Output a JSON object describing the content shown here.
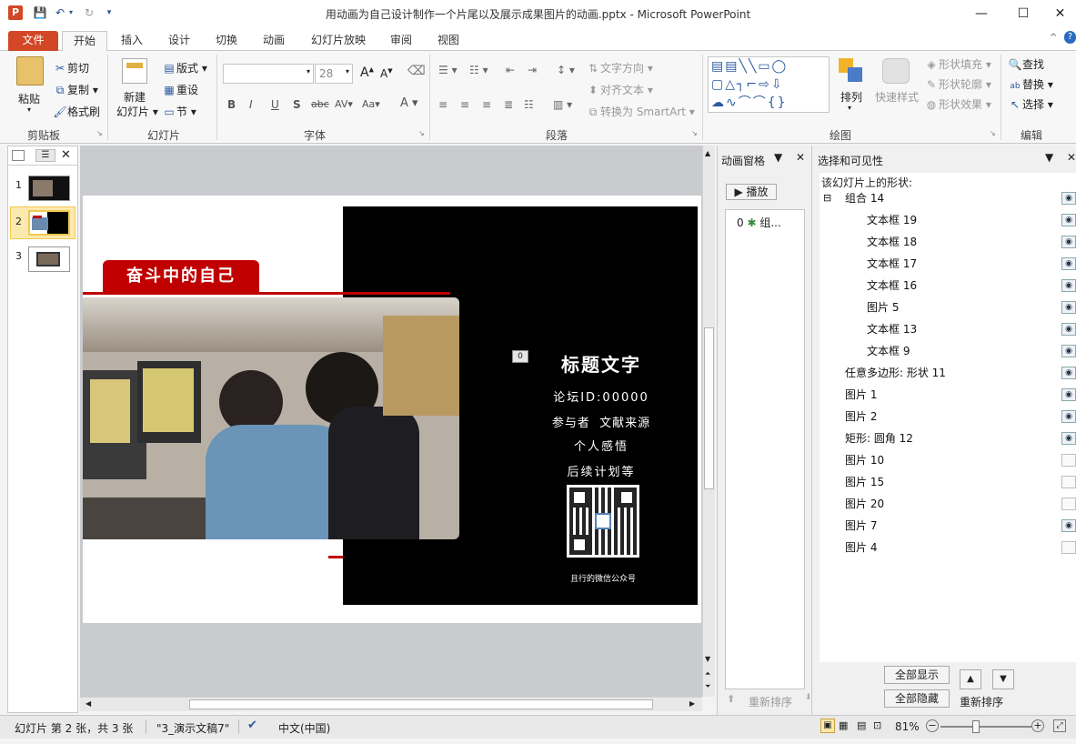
{
  "window": {
    "title": "用动画为自己设计制作一个片尾以及展示成果图片的动画.pptx - Microsoft PowerPoint",
    "app_icon": "P",
    "controls": {
      "minimize": "—",
      "maximize": "☐",
      "close": "✕"
    }
  },
  "tabs": [
    "文件",
    "开始",
    "插入",
    "设计",
    "切换",
    "动画",
    "幻灯片放映",
    "审阅",
    "视图"
  ],
  "active_tab": "开始",
  "ribbon": {
    "clipboard": {
      "paste": "粘贴",
      "cut": "剪切",
      "copy": "复制",
      "format_painter": "格式刷",
      "label": "剪贴板"
    },
    "slides": {
      "new_slide_1": "新建",
      "new_slide_2": "幻灯片",
      "layout": "版式",
      "reset": "重设",
      "section": "节",
      "label": "幻灯片"
    },
    "font": {
      "font_name": "",
      "font_size": "28",
      "label": "字体",
      "grow": "A",
      "shrink": "A",
      "bold": "B",
      "italic": "I",
      "underline": "U",
      "shadow": "S",
      "strike": "abc",
      "spacing": "AV",
      "case": "Aa",
      "color": "A"
    },
    "paragraph": {
      "text_direction": "文字方向",
      "align_text": "对齐文本",
      "smartart": "转换为 SmartArt",
      "label": "段落"
    },
    "drawing": {
      "arrange": "排列",
      "quick_styles": "快速样式",
      "shape_fill": "形状填充",
      "shape_outline": "形状轮廓",
      "shape_effects": "形状效果",
      "label": "绘图"
    },
    "editing": {
      "find": "查找",
      "replace": "替换",
      "select": "选择",
      "label": "编辑"
    }
  },
  "slides_pane": {
    "thumbnails": [
      "1",
      "2",
      "3"
    ],
    "selected": "2"
  },
  "slide": {
    "banner": "奋斗中的自己",
    "anim_tag": "0",
    "title": "标题文字",
    "lines": [
      "论坛ID:00000",
      "参与者  文献来源",
      "个人感悟",
      "后续计划等"
    ],
    "qr_caption": "且行的微信公众号"
  },
  "animation_pane": {
    "title": "动画窗格",
    "play": "播放",
    "item": {
      "index": "0",
      "label": "组..."
    },
    "reorder": "重新排序"
  },
  "selection_pane": {
    "title": "选择和可见性",
    "subtitle": "该幻灯片上的形状:",
    "items": [
      {
        "name": "组合  14",
        "level": 0,
        "expander": "⊟",
        "visible": true
      },
      {
        "name": "文本框  19",
        "level": 1,
        "visible": true
      },
      {
        "name": "文本框  18",
        "level": 1,
        "visible": true
      },
      {
        "name": "文本框  17",
        "level": 1,
        "visible": true
      },
      {
        "name": "文本框  16",
        "level": 1,
        "visible": true
      },
      {
        "name": "图片  5",
        "level": 1,
        "visible": true
      },
      {
        "name": "文本框  13",
        "level": 1,
        "visible": true
      },
      {
        "name": "文本框  9",
        "level": 1,
        "visible": true
      },
      {
        "name": "任意多边形: 形状  11",
        "level": 0,
        "visible": true
      },
      {
        "name": "图片  1",
        "level": 0,
        "visible": true
      },
      {
        "name": "图片  2",
        "level": 0,
        "visible": true
      },
      {
        "name": "矩形: 圆角  12",
        "level": 0,
        "visible": true
      },
      {
        "name": "图片  10",
        "level": 0,
        "visible": false
      },
      {
        "name": "图片  15",
        "level": 0,
        "visible": false
      },
      {
        "name": "图片  20",
        "level": 0,
        "visible": false
      },
      {
        "name": "图片  7",
        "level": 0,
        "visible": true
      },
      {
        "name": "图片  4",
        "level": 0,
        "visible": false
      }
    ],
    "show_all": "全部显示",
    "hide_all": "全部隐藏",
    "reorder": "重新排序"
  },
  "status_bar": {
    "slide_info": "幻灯片 第 2 张，共 3 张",
    "theme": "\"3_演示文稿7\"",
    "language": "中文(中国)",
    "zoom": "81%"
  },
  "colors": {
    "file_tab": "#d24726",
    "banner_red": "#c00000",
    "slide_black": "#000000",
    "thumb_selected": "#f2c94c"
  }
}
